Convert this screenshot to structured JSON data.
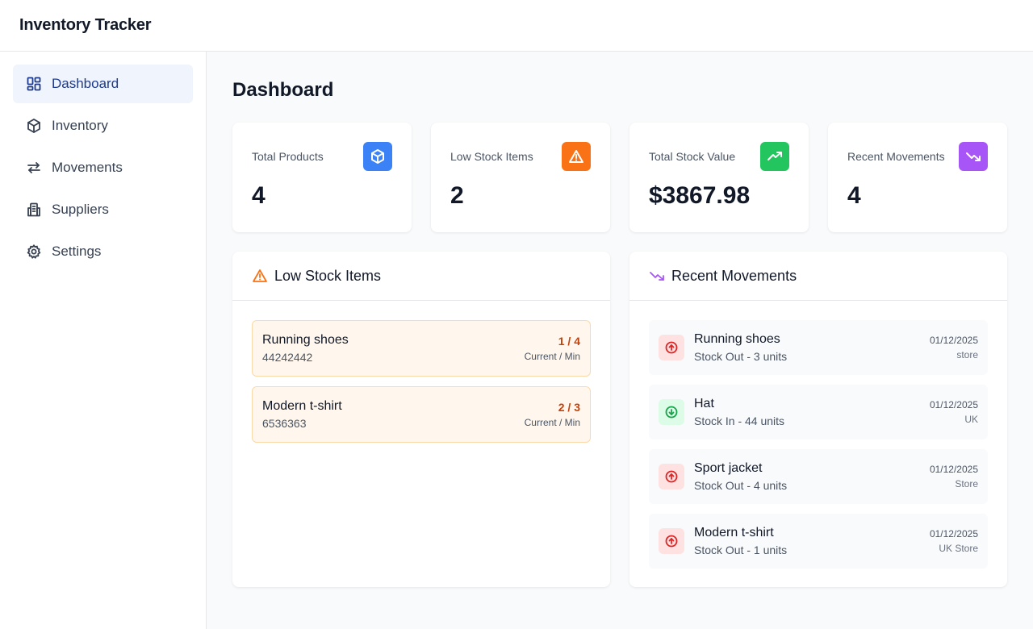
{
  "app": {
    "title": "Inventory Tracker"
  },
  "sidebar": {
    "items": [
      {
        "label": "Dashboard",
        "icon": "dashboard-icon",
        "active": true
      },
      {
        "label": "Inventory",
        "icon": "box-icon"
      },
      {
        "label": "Movements",
        "icon": "arrows-icon"
      },
      {
        "label": "Suppliers",
        "icon": "building-icon"
      },
      {
        "label": "Settings",
        "icon": "gear-icon"
      }
    ]
  },
  "page": {
    "title": "Dashboard"
  },
  "stats": [
    {
      "label": "Total Products",
      "value": "4",
      "icon": "box-icon",
      "color": "#3b82f6"
    },
    {
      "label": "Low Stock Items",
      "value": "2",
      "icon": "warning-icon",
      "color": "#f97316"
    },
    {
      "label": "Total Stock Value",
      "value": "$3867.98",
      "icon": "trending-up-icon",
      "color": "#22c55e"
    },
    {
      "label": "Recent Movements",
      "value": "4",
      "icon": "trending-down-icon",
      "color": "#a855f7"
    }
  ],
  "low_stock": {
    "title": "Low Stock Items",
    "items": [
      {
        "name": "Running shoes",
        "sku": "44242442",
        "ratio": "1 / 4",
        "sub": "Current / Min"
      },
      {
        "name": "Modern t-shirt",
        "sku": "6536363",
        "ratio": "2 / 3",
        "sub": "Current / Min"
      }
    ]
  },
  "recent_movements": {
    "title": "Recent Movements",
    "items": [
      {
        "name": "Running shoes",
        "desc": "Stock Out - 3 units",
        "date": "01/12/2025",
        "location": "store",
        "direction": "out"
      },
      {
        "name": "Hat",
        "desc": "Stock In - 44 units",
        "date": "01/12/2025",
        "location": "UK",
        "direction": "in"
      },
      {
        "name": "Sport jacket",
        "desc": "Stock Out - 4 units",
        "date": "01/12/2025",
        "location": "Store",
        "direction": "out"
      },
      {
        "name": "Modern t-shirt",
        "desc": "Stock Out - 1 units",
        "date": "01/12/2025",
        "location": "UK Store",
        "direction": "out"
      }
    ]
  },
  "colors": {
    "out_bg": "#fee2e2",
    "out_fg": "#dc2626",
    "in_bg": "#dcfce7",
    "in_fg": "#16a34a",
    "warning": "#f97316",
    "purple": "#a855f7"
  }
}
